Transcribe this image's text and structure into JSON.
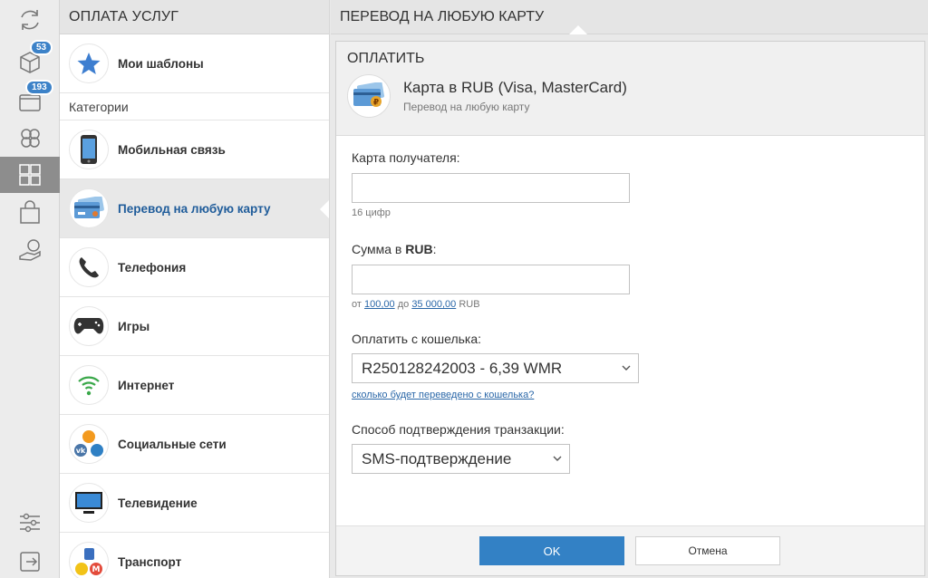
{
  "rail": {
    "items": [
      {
        "name": "refresh-icon"
      },
      {
        "name": "box-icon",
        "badge": "53"
      },
      {
        "name": "wallet-icon",
        "badge": "193"
      },
      {
        "name": "contacts-icon"
      },
      {
        "name": "services-icon"
      },
      {
        "name": "shopping-bag-icon"
      },
      {
        "name": "hand-coin-icon"
      },
      {
        "name": "settings-sliders-icon"
      },
      {
        "name": "logout-icon"
      }
    ]
  },
  "categories": {
    "header": "ОПЛАТА УСЛУГ",
    "templates_label": "Мои шаблоны",
    "section_label": "Категории",
    "items": [
      {
        "label": "Мобильная связь",
        "icon": "phone-icon"
      },
      {
        "label": "Перевод на любую карту",
        "icon": "bank-card-icon",
        "active": true
      },
      {
        "label": "Телефония",
        "icon": "telephone-handset-icon"
      },
      {
        "label": "Игры",
        "icon": "gamepad-icon"
      },
      {
        "label": "Интернет",
        "icon": "wifi-icon"
      },
      {
        "label": "Социальные сети",
        "icon": "social-networks-icon"
      },
      {
        "label": "Телевидение",
        "icon": "tv-icon"
      },
      {
        "label": "Транспорт",
        "icon": "transport-icon"
      }
    ]
  },
  "panel": {
    "header": "ПЕРЕВОД НА ЛЮБУЮ КАРТУ",
    "pay_title": "ОПЛАТИТЬ",
    "provider_name": "Карта в RUB (Visa, MasterCard)",
    "provider_sub": "Перевод на любую карту"
  },
  "form": {
    "card_label": "Карта получателя:",
    "card_value": "",
    "card_hint": "16 цифр",
    "amount_label_prefix": "Сумма в ",
    "amount_label_currency": "RUB",
    "amount_label_suffix": ":",
    "amount_value": "",
    "amount_hint_from": "от",
    "amount_min": "100,00",
    "amount_hint_to": "до",
    "amount_max": "35 000,00",
    "amount_hint_currency": "RUB",
    "wallet_label": "Оплатить с кошелька:",
    "wallet_selected": "R250128242003 - 6,39 WMR",
    "wallet_link": "сколько будет переведено с кошелька?",
    "confirm_label": "Способ подтверждения транзакции:",
    "confirm_selected": "SMS-подтверждение"
  },
  "footer": {
    "ok_label": "OK",
    "cancel_label": "Отмена"
  },
  "colors": {
    "accent": "#3381c5",
    "active_text": "#1f5c9a",
    "badge": "#3c82c8"
  }
}
